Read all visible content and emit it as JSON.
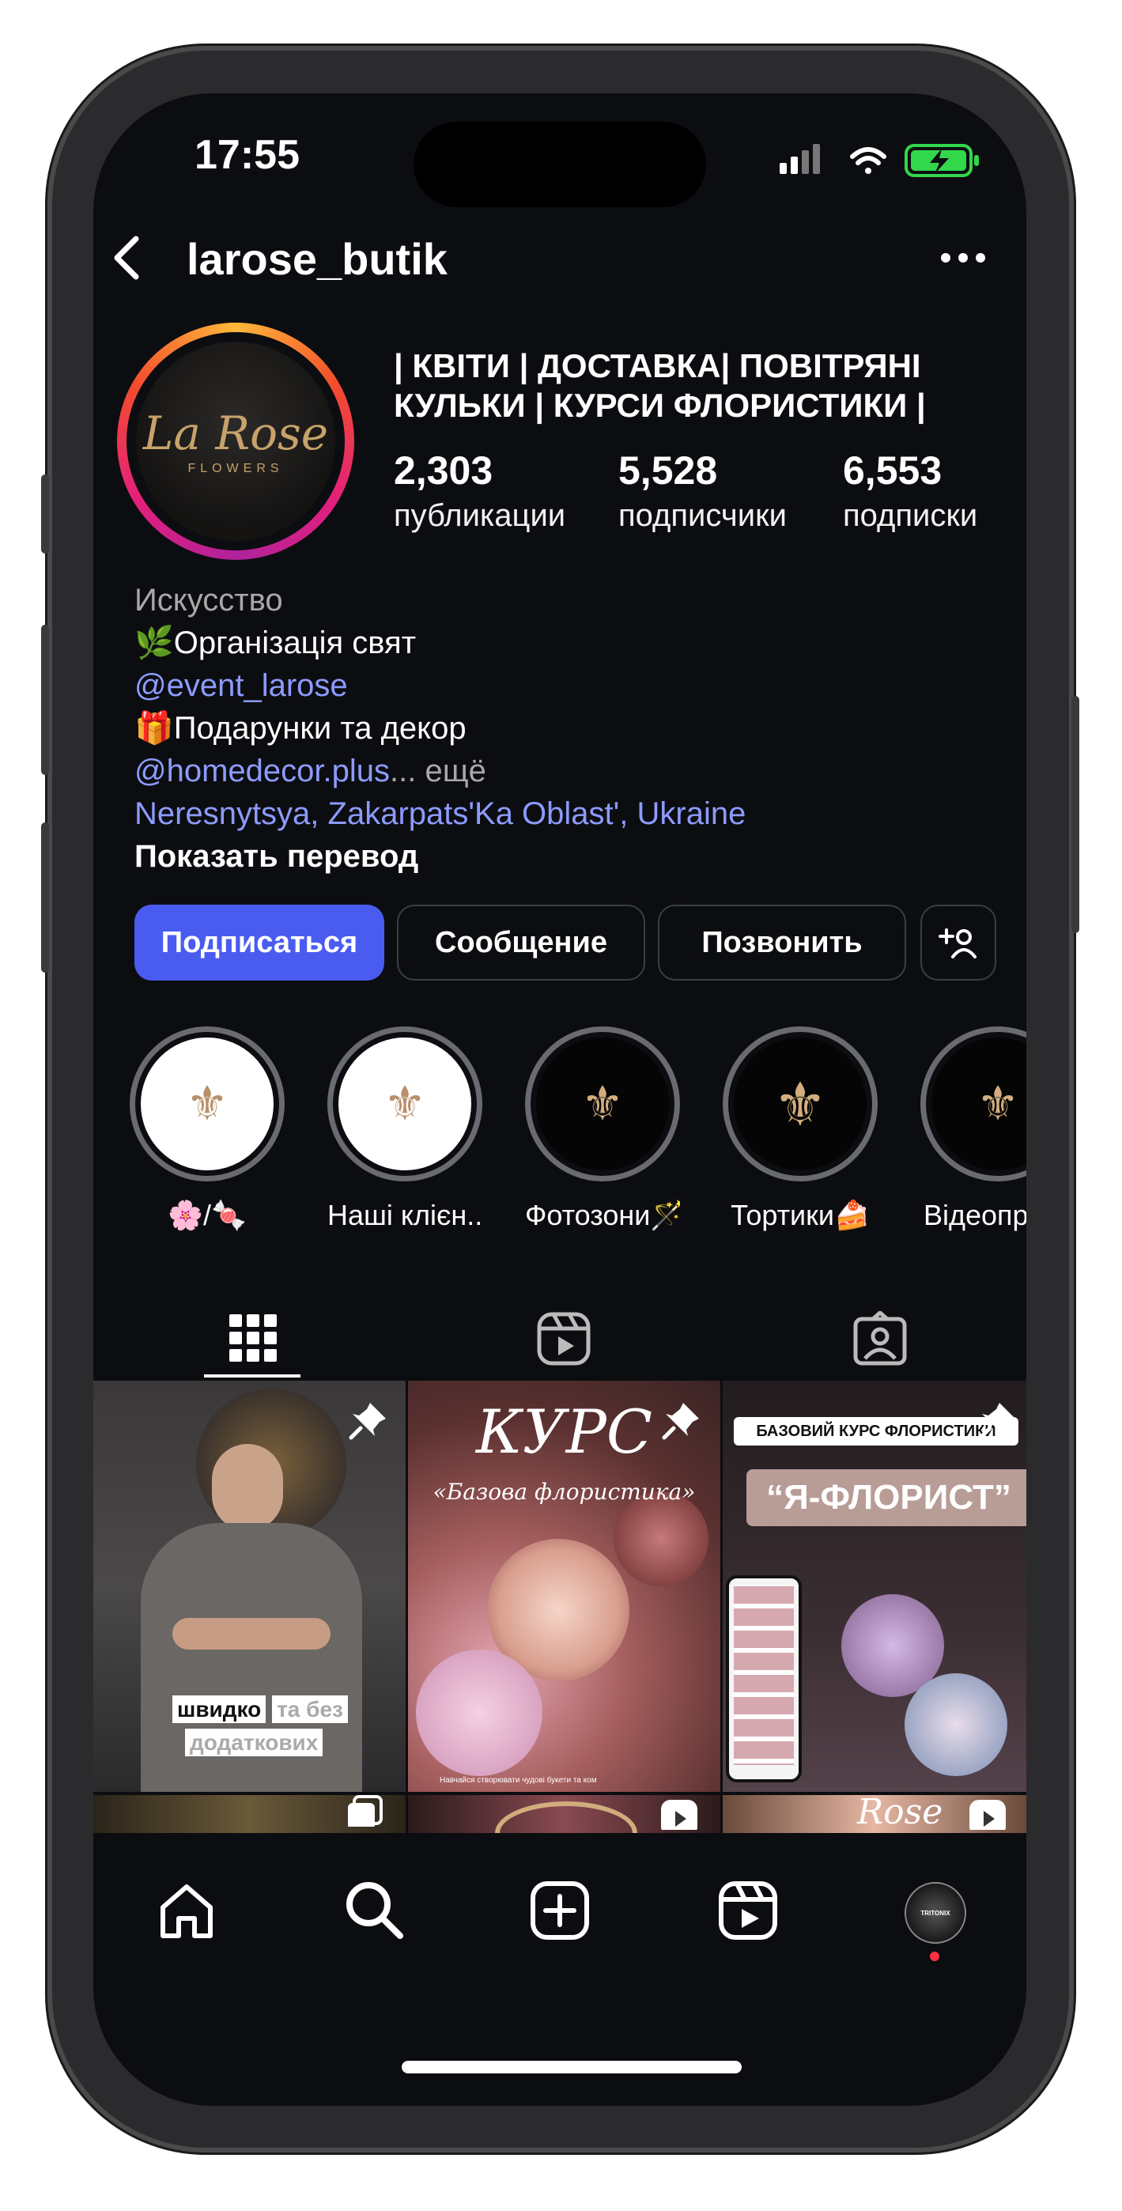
{
  "status": {
    "time": "17:55"
  },
  "header": {
    "username": "larose_butik",
    "back_icon": "chevron-left-icon",
    "more_icon": "ellipsis-icon"
  },
  "avatar": {
    "logo": "La Rose",
    "sub": "FLOWERS"
  },
  "headline": "| КВІТИ | ДОСТАВКА| ПОВІТРЯНІ КУЛЬКИ | КУРСИ ФЛОРИСТИКИ |",
  "stats": [
    {
      "value": "2,303",
      "label": "публикации"
    },
    {
      "value": "5,528",
      "label": "подписчики"
    },
    {
      "value": "6,553",
      "label": "подписки"
    }
  ],
  "bio": {
    "category": "Искусство",
    "line1": "🌿Організація свят",
    "link1": "@event_larose",
    "line2": "🎁Подарунки та декор",
    "link2": "@homedecor.plus",
    "more": "... ещё",
    "location": "Neresnytsya, Zakarpats'Ka Oblast', Ukraine",
    "translate": "Показать перевод"
  },
  "actions": {
    "follow": "Подписаться",
    "message": "Сообщение",
    "call": "Позвонить"
  },
  "highlights": [
    {
      "label": "🌸/🍬",
      "style": "light"
    },
    {
      "label": "Наші клієн...",
      "style": "light"
    },
    {
      "label": "Фотозони🪄",
      "style": "dark"
    },
    {
      "label": "Тортики🍰",
      "style": "dark"
    },
    {
      "label": "Відеопри",
      "style": "dark"
    }
  ],
  "posts": {
    "p1_caption_a": "швидко",
    "p1_caption_b": "та без",
    "p1_caption_c": "додаткових",
    "p2_title": "КУРС",
    "p2_subtitle": "«Базова флористика»",
    "p2_footer": "Навчайся створювати чудові букети та ком",
    "p3_banner": "БАЗОВИЙ КУРС ФЛОРИСТИКИ",
    "p3_title": "“Я-ФЛОРИСТ”",
    "p6_logo": "Rose"
  },
  "nav": {
    "profile_text": "TRITONIX"
  },
  "colors": {
    "accent": "#4a5cf0",
    "link": "#8c9bff",
    "background": "#0c0d10"
  }
}
